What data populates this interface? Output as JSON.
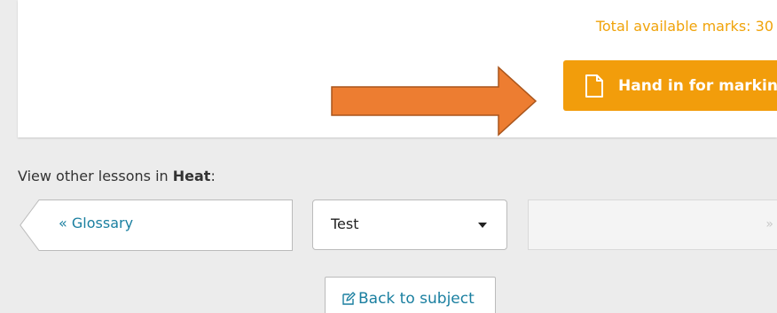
{
  "card": {
    "total_marks": "Total available marks: 30",
    "hand_in_label": "Hand in for marking",
    "hand_in_icon": "document-icon",
    "accent_color": "#f29d0b",
    "arrow_color": "#ed7d31"
  },
  "navigation": {
    "view_other_prefix": "View other lessons in ",
    "topic": "Heat",
    "view_other_suffix": ":",
    "prev_symbol": "«",
    "prev_label": "Glossary",
    "selected_lesson": "Test",
    "next_symbol": "»"
  },
  "footer": {
    "back_label": "Back to subject",
    "back_icon": "back-edit-icon"
  }
}
